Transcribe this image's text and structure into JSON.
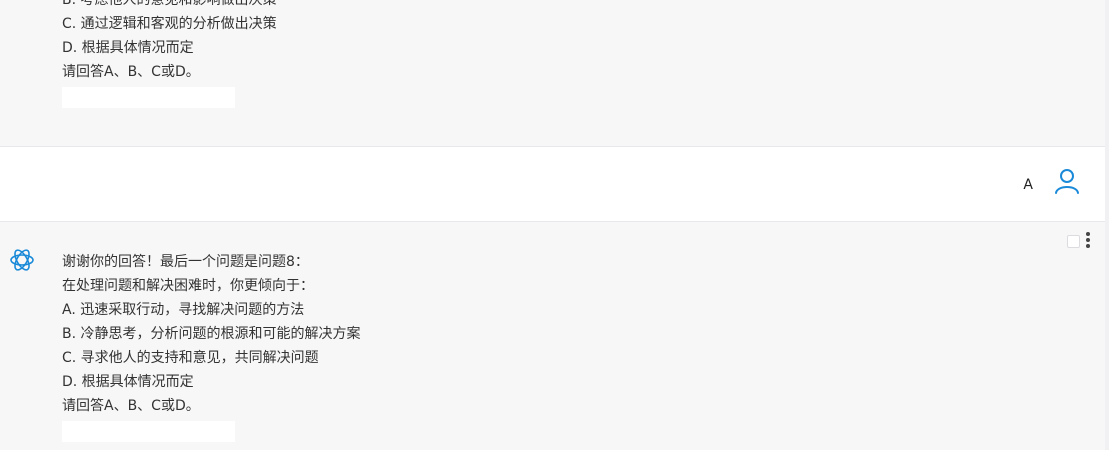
{
  "messages": [
    {
      "role": "assistant",
      "lines": [
        "B. 考虑他人的意见和影响做出决策",
        "C. 通过逻辑和客观的分析做出决策",
        "D. 根据具体情况而定",
        "请回答A、B、C或D。"
      ]
    },
    {
      "role": "user",
      "text": "A"
    },
    {
      "role": "assistant",
      "lines": [
        "谢谢你的回答！最后一个问题是问题8：",
        "在处理问题和解决困难时，你更倾向于：",
        "A. 迅速采取行动，寻找解决问题的方法",
        "B. 冷静思考，分析问题的根源和可能的解决方案",
        "C. 寻求他人的支持和意见，共同解决问题",
        "D. 根据具体情况而定",
        "请回答A、B、C或D。"
      ]
    }
  ],
  "icons": {
    "assistant_logo": "openai-logo-icon",
    "user_avatar": "user-avatar-icon",
    "copy": "copy-icon",
    "more": "more-vertical-icon"
  },
  "colors": {
    "assistant_bg": "#f7f7f8",
    "user_bg": "#ffffff",
    "accent": "#1a8ad8",
    "text": "#333333"
  }
}
